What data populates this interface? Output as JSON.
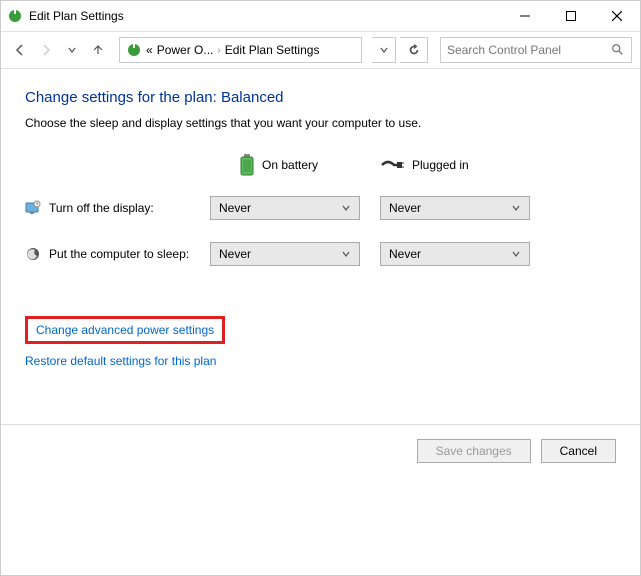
{
  "window": {
    "title": "Edit Plan Settings"
  },
  "breadcrumb": {
    "prefix": "«",
    "part1": "Power O...",
    "part2": "Edit Plan Settings"
  },
  "search": {
    "placeholder": "Search Control Panel"
  },
  "page": {
    "heading": "Change settings for the plan: Balanced",
    "subtext": "Choose the sleep and display settings that you want your computer to use."
  },
  "columns": {
    "battery": "On battery",
    "plugged": "Plugged in"
  },
  "settings": {
    "display": {
      "label": "Turn off the display:",
      "battery_value": "Never",
      "plugged_value": "Never"
    },
    "sleep": {
      "label": "Put the computer to sleep:",
      "battery_value": "Never",
      "plugged_value": "Never"
    }
  },
  "links": {
    "advanced": "Change advanced power settings",
    "restore": "Restore default settings for this plan"
  },
  "buttons": {
    "save": "Save changes",
    "cancel": "Cancel"
  }
}
